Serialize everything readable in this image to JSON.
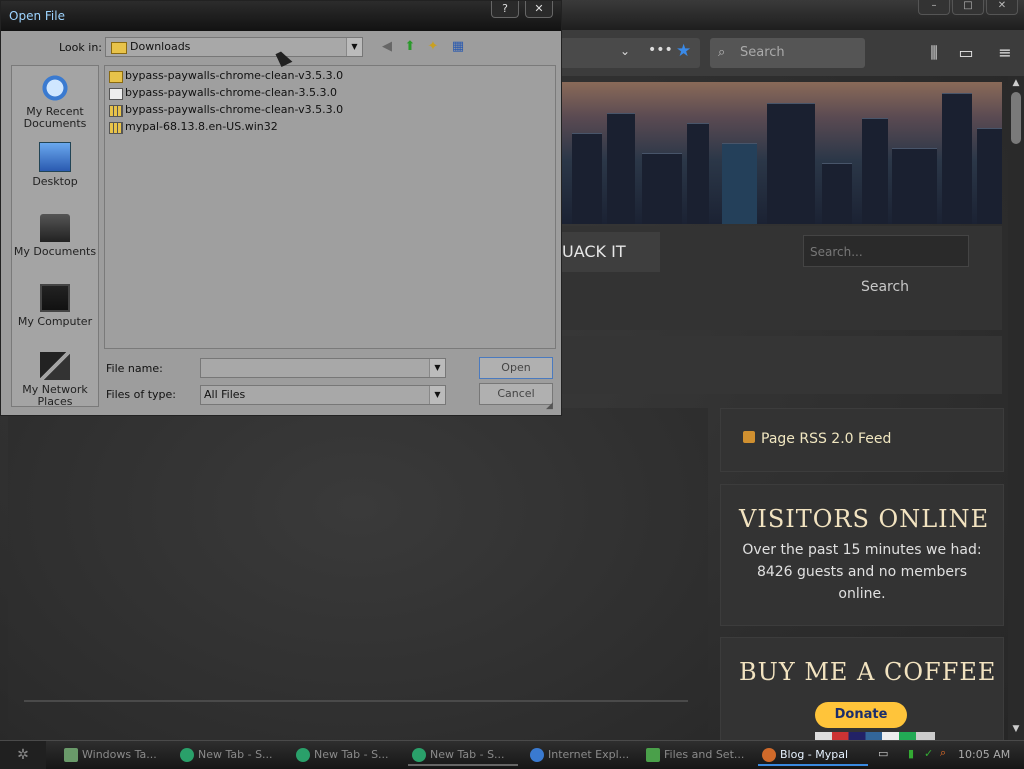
{
  "dialog": {
    "title": "Open File",
    "help_btn": "?",
    "close_btn": "✕",
    "look_in_label": "Look in:",
    "look_in_value": "Downloads",
    "places": [
      "My Recent Documents",
      "Desktop",
      "My Documents",
      "My Computer",
      "My Network Places"
    ],
    "files": [
      {
        "name": "bypass-paywalls-chrome-clean-v3.5.3.0",
        "icon": "folder-icon"
      },
      {
        "name": "bypass-paywalls-chrome-clean-3.5.3.0",
        "icon": "file-icon"
      },
      {
        "name": "bypass-paywalls-chrome-clean-v3.5.3.0",
        "icon": "zip-icon"
      },
      {
        "name": "mypal-68.13.8.en-US.win32",
        "icon": "zip-icon"
      }
    ],
    "file_name_label": "File name:",
    "file_name_value": "",
    "files_of_type_label": "Files of type:",
    "files_of_type_value": "All Files",
    "open_label": "Open",
    "cancel_label": "Cancel"
  },
  "browser": {
    "search_placeholder": "Search",
    "site_menu_item": "UACK IT",
    "site_search_placeholder": "Search...",
    "site_search_button": "Search",
    "rss_label": "Page RSS 2.0 Feed",
    "visitors_title": "VISITORS ONLINE",
    "visitors_text": "Over the past 15 minutes we had: 8426 guests and no members online.",
    "coffee_title": "BUY ME A COFFEE",
    "donate_label": "Donate"
  },
  "taskbar": {
    "tasks": [
      {
        "label": "Windows Ta...",
        "active": false,
        "color": "#6a9a6a"
      },
      {
        "label": "New Tab - S...",
        "active": false,
        "color": "#2aa06a"
      },
      {
        "label": "New Tab - S...",
        "active": false,
        "color": "#2aa06a"
      },
      {
        "label": "New Tab - S...",
        "active": false,
        "color": "#2aa06a"
      },
      {
        "label": "Internet Expl...",
        "active": false,
        "color": "#3a7ad0"
      },
      {
        "label": "Files and Set...",
        "active": false,
        "color": "#4aa04a"
      },
      {
        "label": "Blog - Mypal",
        "active": true,
        "color": "#d06a2a"
      }
    ],
    "clock": "10:05 AM"
  }
}
